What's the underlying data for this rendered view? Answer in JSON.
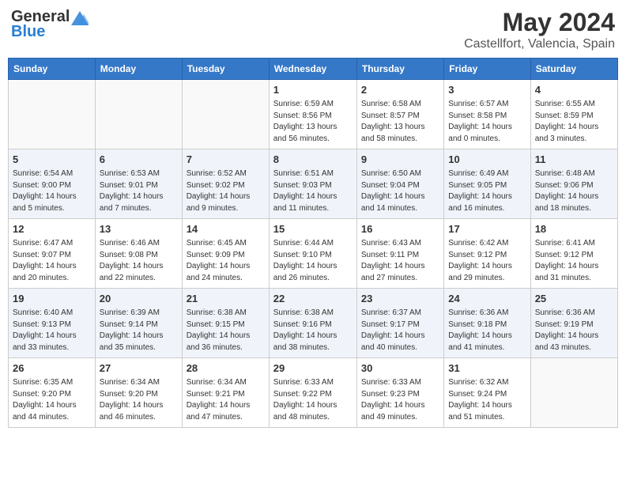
{
  "header": {
    "logo_general": "General",
    "logo_blue": "Blue",
    "title": "May 2024",
    "location": "Castellfort, Valencia, Spain"
  },
  "days_of_week": [
    "Sunday",
    "Monday",
    "Tuesday",
    "Wednesday",
    "Thursday",
    "Friday",
    "Saturday"
  ],
  "weeks": [
    {
      "shade": "white",
      "days": [
        {
          "number": "",
          "sunrise": "",
          "sunset": "",
          "daylight": "",
          "daylight2": ""
        },
        {
          "number": "",
          "sunrise": "",
          "sunset": "",
          "daylight": "",
          "daylight2": ""
        },
        {
          "number": "",
          "sunrise": "",
          "sunset": "",
          "daylight": "",
          "daylight2": ""
        },
        {
          "number": "1",
          "sunrise": "Sunrise: 6:59 AM",
          "sunset": "Sunset: 8:56 PM",
          "daylight": "Daylight: 13 hours",
          "daylight2": "and 56 minutes."
        },
        {
          "number": "2",
          "sunrise": "Sunrise: 6:58 AM",
          "sunset": "Sunset: 8:57 PM",
          "daylight": "Daylight: 13 hours",
          "daylight2": "and 58 minutes."
        },
        {
          "number": "3",
          "sunrise": "Sunrise: 6:57 AM",
          "sunset": "Sunset: 8:58 PM",
          "daylight": "Daylight: 14 hours",
          "daylight2": "and 0 minutes."
        },
        {
          "number": "4",
          "sunrise": "Sunrise: 6:55 AM",
          "sunset": "Sunset: 8:59 PM",
          "daylight": "Daylight: 14 hours",
          "daylight2": "and 3 minutes."
        }
      ]
    },
    {
      "shade": "shaded",
      "days": [
        {
          "number": "5",
          "sunrise": "Sunrise: 6:54 AM",
          "sunset": "Sunset: 9:00 PM",
          "daylight": "Daylight: 14 hours",
          "daylight2": "and 5 minutes."
        },
        {
          "number": "6",
          "sunrise": "Sunrise: 6:53 AM",
          "sunset": "Sunset: 9:01 PM",
          "daylight": "Daylight: 14 hours",
          "daylight2": "and 7 minutes."
        },
        {
          "number": "7",
          "sunrise": "Sunrise: 6:52 AM",
          "sunset": "Sunset: 9:02 PM",
          "daylight": "Daylight: 14 hours",
          "daylight2": "and 9 minutes."
        },
        {
          "number": "8",
          "sunrise": "Sunrise: 6:51 AM",
          "sunset": "Sunset: 9:03 PM",
          "daylight": "Daylight: 14 hours",
          "daylight2": "and 11 minutes."
        },
        {
          "number": "9",
          "sunrise": "Sunrise: 6:50 AM",
          "sunset": "Sunset: 9:04 PM",
          "daylight": "Daylight: 14 hours",
          "daylight2": "and 14 minutes."
        },
        {
          "number": "10",
          "sunrise": "Sunrise: 6:49 AM",
          "sunset": "Sunset: 9:05 PM",
          "daylight": "Daylight: 14 hours",
          "daylight2": "and 16 minutes."
        },
        {
          "number": "11",
          "sunrise": "Sunrise: 6:48 AM",
          "sunset": "Sunset: 9:06 PM",
          "daylight": "Daylight: 14 hours",
          "daylight2": "and 18 minutes."
        }
      ]
    },
    {
      "shade": "white",
      "days": [
        {
          "number": "12",
          "sunrise": "Sunrise: 6:47 AM",
          "sunset": "Sunset: 9:07 PM",
          "daylight": "Daylight: 14 hours",
          "daylight2": "and 20 minutes."
        },
        {
          "number": "13",
          "sunrise": "Sunrise: 6:46 AM",
          "sunset": "Sunset: 9:08 PM",
          "daylight": "Daylight: 14 hours",
          "daylight2": "and 22 minutes."
        },
        {
          "number": "14",
          "sunrise": "Sunrise: 6:45 AM",
          "sunset": "Sunset: 9:09 PM",
          "daylight": "Daylight: 14 hours",
          "daylight2": "and 24 minutes."
        },
        {
          "number": "15",
          "sunrise": "Sunrise: 6:44 AM",
          "sunset": "Sunset: 9:10 PM",
          "daylight": "Daylight: 14 hours",
          "daylight2": "and 26 minutes."
        },
        {
          "number": "16",
          "sunrise": "Sunrise: 6:43 AM",
          "sunset": "Sunset: 9:11 PM",
          "daylight": "Daylight: 14 hours",
          "daylight2": "and 27 minutes."
        },
        {
          "number": "17",
          "sunrise": "Sunrise: 6:42 AM",
          "sunset": "Sunset: 9:12 PM",
          "daylight": "Daylight: 14 hours",
          "daylight2": "and 29 minutes."
        },
        {
          "number": "18",
          "sunrise": "Sunrise: 6:41 AM",
          "sunset": "Sunset: 9:12 PM",
          "daylight": "Daylight: 14 hours",
          "daylight2": "and 31 minutes."
        }
      ]
    },
    {
      "shade": "shaded",
      "days": [
        {
          "number": "19",
          "sunrise": "Sunrise: 6:40 AM",
          "sunset": "Sunset: 9:13 PM",
          "daylight": "Daylight: 14 hours",
          "daylight2": "and 33 minutes."
        },
        {
          "number": "20",
          "sunrise": "Sunrise: 6:39 AM",
          "sunset": "Sunset: 9:14 PM",
          "daylight": "Daylight: 14 hours",
          "daylight2": "and 35 minutes."
        },
        {
          "number": "21",
          "sunrise": "Sunrise: 6:38 AM",
          "sunset": "Sunset: 9:15 PM",
          "daylight": "Daylight: 14 hours",
          "daylight2": "and 36 minutes."
        },
        {
          "number": "22",
          "sunrise": "Sunrise: 6:38 AM",
          "sunset": "Sunset: 9:16 PM",
          "daylight": "Daylight: 14 hours",
          "daylight2": "and 38 minutes."
        },
        {
          "number": "23",
          "sunrise": "Sunrise: 6:37 AM",
          "sunset": "Sunset: 9:17 PM",
          "daylight": "Daylight: 14 hours",
          "daylight2": "and 40 minutes."
        },
        {
          "number": "24",
          "sunrise": "Sunrise: 6:36 AM",
          "sunset": "Sunset: 9:18 PM",
          "daylight": "Daylight: 14 hours",
          "daylight2": "and 41 minutes."
        },
        {
          "number": "25",
          "sunrise": "Sunrise: 6:36 AM",
          "sunset": "Sunset: 9:19 PM",
          "daylight": "Daylight: 14 hours",
          "daylight2": "and 43 minutes."
        }
      ]
    },
    {
      "shade": "white",
      "days": [
        {
          "number": "26",
          "sunrise": "Sunrise: 6:35 AM",
          "sunset": "Sunset: 9:20 PM",
          "daylight": "Daylight: 14 hours",
          "daylight2": "and 44 minutes."
        },
        {
          "number": "27",
          "sunrise": "Sunrise: 6:34 AM",
          "sunset": "Sunset: 9:20 PM",
          "daylight": "Daylight: 14 hours",
          "daylight2": "and 46 minutes."
        },
        {
          "number": "28",
          "sunrise": "Sunrise: 6:34 AM",
          "sunset": "Sunset: 9:21 PM",
          "daylight": "Daylight: 14 hours",
          "daylight2": "and 47 minutes."
        },
        {
          "number": "29",
          "sunrise": "Sunrise: 6:33 AM",
          "sunset": "Sunset: 9:22 PM",
          "daylight": "Daylight: 14 hours",
          "daylight2": "and 48 minutes."
        },
        {
          "number": "30",
          "sunrise": "Sunrise: 6:33 AM",
          "sunset": "Sunset: 9:23 PM",
          "daylight": "Daylight: 14 hours",
          "daylight2": "and 49 minutes."
        },
        {
          "number": "31",
          "sunrise": "Sunrise: 6:32 AM",
          "sunset": "Sunset: 9:24 PM",
          "daylight": "Daylight: 14 hours",
          "daylight2": "and 51 minutes."
        },
        {
          "number": "",
          "sunrise": "",
          "sunset": "",
          "daylight": "",
          "daylight2": ""
        }
      ]
    }
  ]
}
